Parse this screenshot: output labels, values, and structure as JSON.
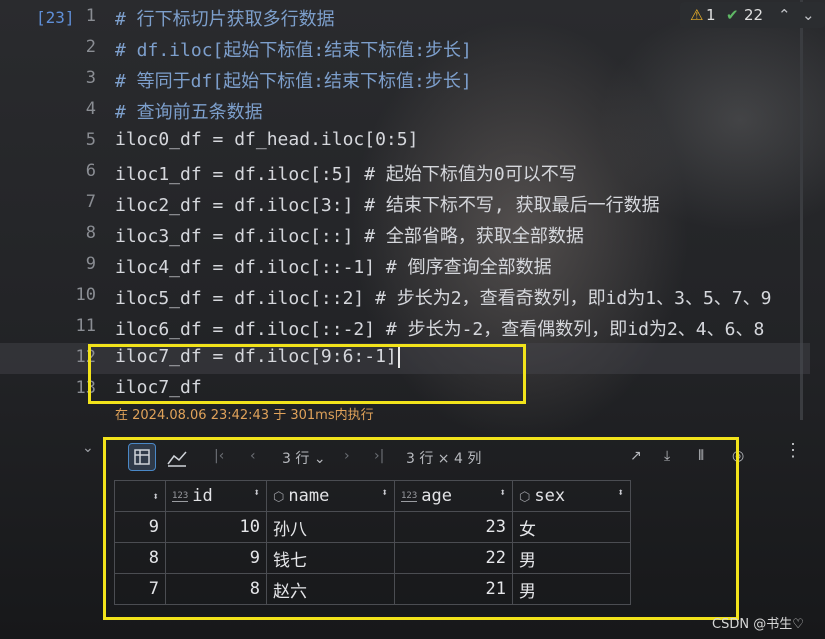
{
  "cell": {
    "number": "[23]"
  },
  "lines": [
    {
      "n": "1",
      "code": "# 行下标切片获取多行数据"
    },
    {
      "n": "2",
      "code": "# df.iloc[起始下标值:结束下标值:步长]"
    },
    {
      "n": "3",
      "code": "# 等同于df[起始下标值:结束下标值:步长]"
    },
    {
      "n": "4",
      "code": "# 查询前五条数据"
    },
    {
      "n": "5",
      "code": "iloc0_df = df_head.iloc[0:5]"
    },
    {
      "n": "6",
      "code": "iloc1_df = df.iloc[:5] # 起始下标值为0可以不写"
    },
    {
      "n": "7",
      "code": "iloc2_df = df.iloc[3:] # 结束下标不写, 获取最后一行数据"
    },
    {
      "n": "8",
      "code": "iloc3_df = df.iloc[::] # 全部省略，获取全部数据"
    },
    {
      "n": "9",
      "code": "iloc4_df = df.iloc[::-1] # 倒序查询全部数据"
    },
    {
      "n": "10",
      "code": "iloc5_df = df.iloc[::2] # 步长为2，查看奇数列，即id为1、3、5、7、9"
    },
    {
      "n": "11",
      "code": "iloc6_df = df.iloc[::-2] # 步长为-2，查看偶数列，即id为2、4、6、8"
    },
    {
      "n": "12",
      "code": "iloc7_df = df.iloc[9:6:-1]"
    },
    {
      "n": "13",
      "code": "iloc7_df"
    }
  ],
  "status": "在 2024.08.06 23:42:43 于 301ms内执行",
  "inspections": {
    "warnings": "1",
    "ok": "22"
  },
  "result_toolbar": {
    "rows_select": "3 行",
    "shape": "3 行 × 4 列"
  },
  "table": {
    "columns": [
      "id",
      "name",
      "age",
      "sex"
    ],
    "rows": [
      {
        "idx": "9",
        "id": "10",
        "name": "孙八",
        "age": "23",
        "sex": "女"
      },
      {
        "idx": "8",
        "id": "9",
        "name": "钱七",
        "age": "22",
        "sex": "男"
      },
      {
        "idx": "7",
        "id": "8",
        "name": "赵六",
        "age": "21",
        "sex": "男"
      }
    ]
  },
  "watermark": "CSDN @书生♡",
  "colors": {
    "highlight_box": "#f2e31b",
    "comment": "#7d9fcc",
    "number": "#42a5f5"
  }
}
